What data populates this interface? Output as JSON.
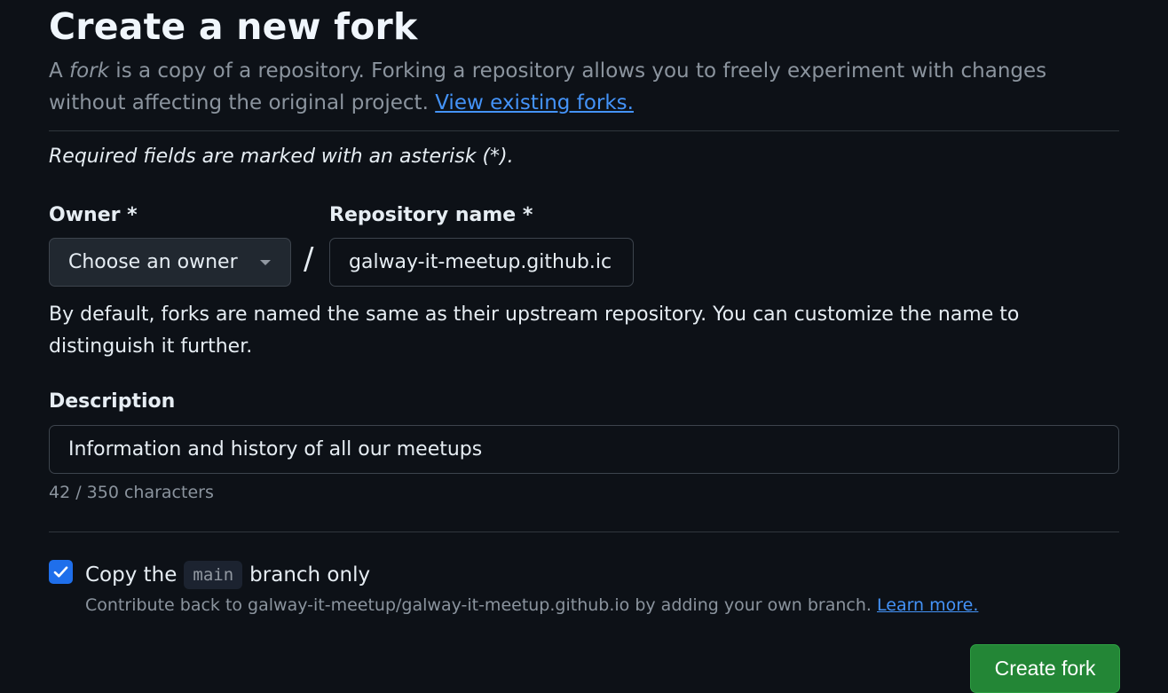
{
  "header": {
    "title": "Create a new fork",
    "intro_prefix": "A ",
    "intro_em": "fork",
    "intro_rest": " is a copy of a repository. Forking a repository allows you to freely experiment with changes without affecting the original project. ",
    "view_forks_link": "View existing forks."
  },
  "form": {
    "required_note": "Required fields are marked with an asterisk (*).",
    "owner_label": "Owner *",
    "owner_select_value": "Choose an owner",
    "slash": "/",
    "repo_label": "Repository name *",
    "repo_value": "galway-it-meetup.github.ic",
    "name_hint": "By default, forks are named the same as their upstream repository. You can customize the name to distinguish it further.",
    "description_label": "Description",
    "description_value": "Information and history of all our meetups",
    "char_count": "42 / 350 characters",
    "copy_prefix": "Copy the",
    "copy_branch": "main",
    "copy_suffix": "branch only",
    "copy_checked": true,
    "contribute_text": "Contribute back to galway-it-meetup/galway-it-meetup.github.io by adding your own branch. ",
    "learn_more_link": "Learn more.",
    "submit_label": "Create fork"
  },
  "colors": {
    "background": "#0d1117",
    "link": "#4493f8",
    "primary_button": "#238636",
    "checkbox": "#1f6feb"
  },
  "icons": {
    "owner_dropdown": "triangle-down-icon",
    "checkbox": "checkmark-icon"
  }
}
